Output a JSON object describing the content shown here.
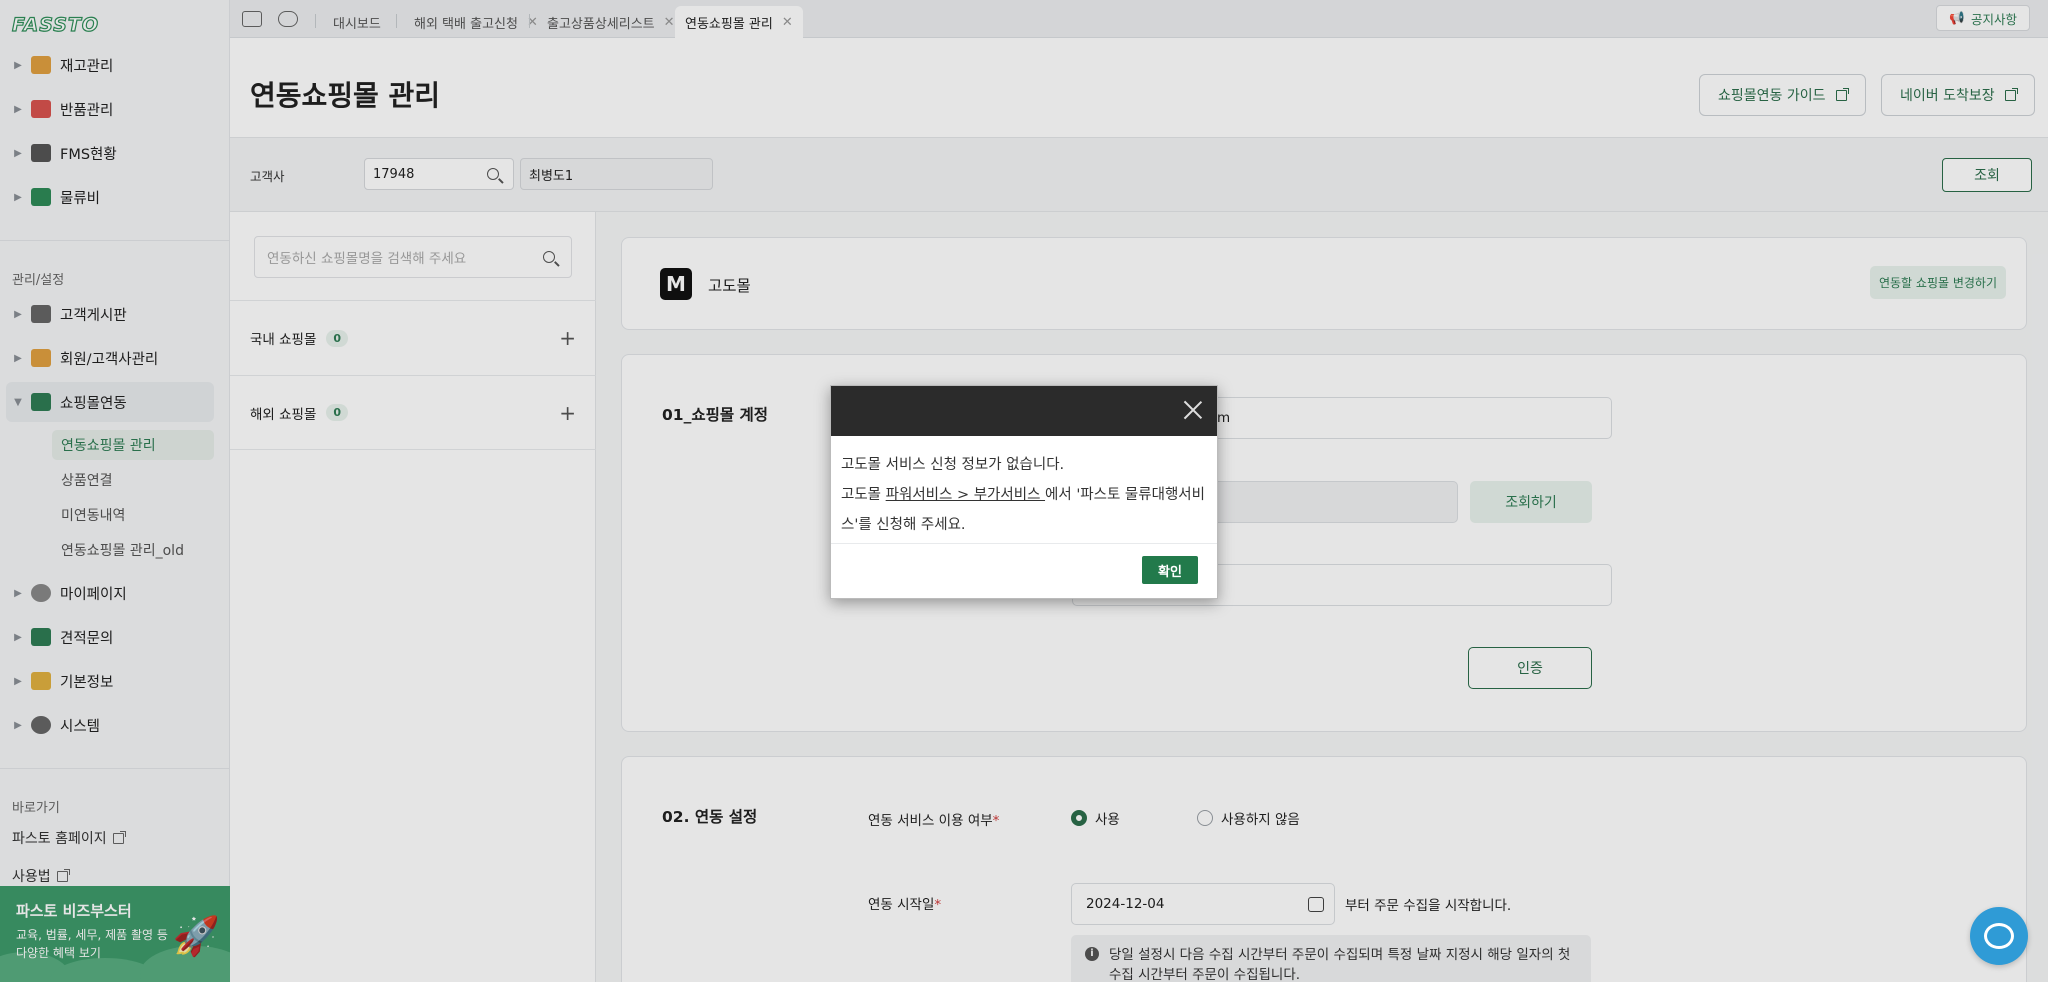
{
  "sidebar": {
    "logo": "FASSTO",
    "top_menu": [
      {
        "label": "재고관리",
        "icon": "box-icon",
        "color": "#e0a040"
      },
      {
        "label": "반품관리",
        "icon": "return-icon",
        "color": "#d9534f"
      },
      {
        "label": "FMS현황",
        "icon": "monitor-icon",
        "color": "#555555"
      },
      {
        "label": "물류비",
        "icon": "ledger-icon",
        "color": "#2e8b57"
      }
    ],
    "settings_label": "관리/설정",
    "settings_menu": [
      {
        "label": "고객게시판",
        "icon": "chat-icon",
        "color": "#666666"
      },
      {
        "label": "회원/고객사관리",
        "icon": "store-icon",
        "color": "#e0a040"
      },
      {
        "label": "쇼핑몰연동",
        "icon": "link-icon",
        "color": "#2e7c54"
      }
    ],
    "sub_items": [
      "연동쇼핑몰 관리",
      "상품연결",
      "미연동내역",
      "연동쇼핑몰 관리_old"
    ],
    "bottom_menu": [
      {
        "label": "마이페이지",
        "icon": "user-icon",
        "color": "#888888"
      },
      {
        "label": "견적문의",
        "icon": "phone-icon",
        "color": "#2e7c54"
      },
      {
        "label": "기본정보",
        "icon": "note-icon",
        "color": "#e0b040"
      },
      {
        "label": "시스템",
        "icon": "gear-icon",
        "color": "#666666"
      }
    ],
    "shortcut_label": "바로가기",
    "shortcuts": [
      "파스토 홈페이지",
      "사용법"
    ],
    "banner": {
      "title": "파스토 비즈부스터",
      "desc": "교육, 법률, 세무, 제품 촬영 등 다양한 혜택 보기"
    }
  },
  "tabs": {
    "items": [
      "대시보드",
      "해외 택배 출고신청",
      "출고상품상세리스트",
      "연동쇼핑몰 관리"
    ],
    "notice": "공지사항"
  },
  "header": {
    "title": "연동쇼핑몰 관리",
    "guide_btn": "쇼핑몰연동 가이드",
    "naver_btn": "네이버 도착보장"
  },
  "filter": {
    "label": "고객사",
    "customer_code": "17948",
    "customer_name": "최병도1",
    "query_btn": "조회"
  },
  "shop_panel": {
    "search_placeholder": "연동하신 쇼핑몰명을 검색해 주세요",
    "domestic": {
      "label": "국내 쇼핑몰",
      "count": "0"
    },
    "overseas": {
      "label": "해외 쇼핑몰",
      "count": "0"
    }
  },
  "store": {
    "logo_letter": "M",
    "name": "고도몰",
    "change_btn": "연동할 쇼핑몰 변경하기"
  },
  "account": {
    "title": "01_쇼핑몰 계정",
    "field1_visible": "m",
    "lookup_btn": "조회하기",
    "auth_btn": "인증"
  },
  "link_settings": {
    "title": "02. 연동 설정",
    "use_label": "연동 서비스 이용 여부",
    "opt_use": "사용",
    "opt_nouse": "사용하지 않음",
    "start_label": "연동 시작일",
    "start_date": "2024-12-04",
    "start_suffix": "부터 주문 수집을 시작합니다.",
    "info_line1": "당일 설정시 다음 수집 시간부터 주문이 수집되며 특정 날짜 지정시 해당 일자의 첫",
    "info_line2": "수집 시간부터 주문이 수집됩니다."
  },
  "modal": {
    "line1": "고도몰 서비스 신청 정보가 없습니다.",
    "line2_pre": "고도몰 ",
    "line2_link": "파워서비스 > 부가서비스 ",
    "line2_post": "에서 '파스토 물류대행서비",
    "line3": "스'를 신청해 주세요.",
    "ok": "확인"
  }
}
